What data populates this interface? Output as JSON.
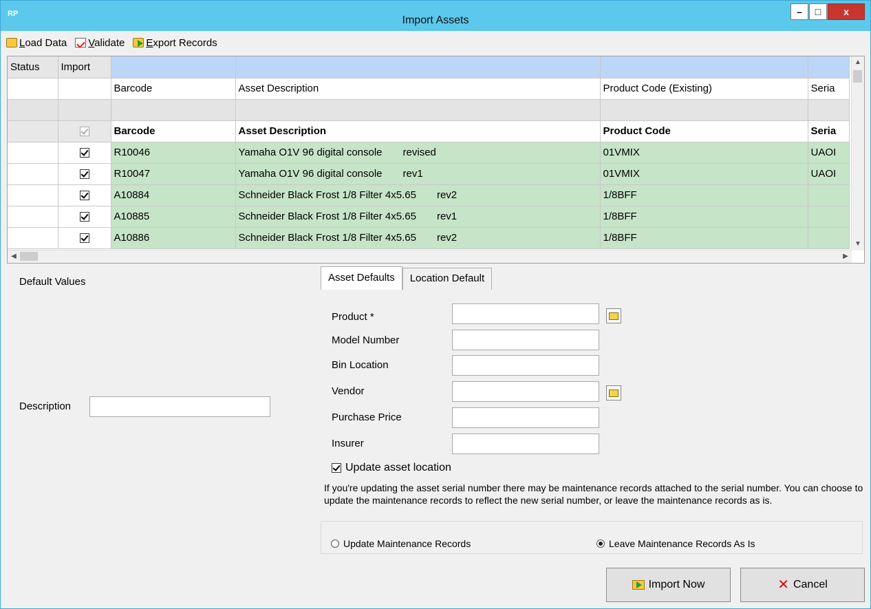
{
  "window": {
    "app_icon": "RP",
    "title": "Import Assets",
    "controls": {
      "minimize": "–",
      "maximize": "□",
      "close": "x"
    }
  },
  "toolbar": {
    "load_data": "Load Data",
    "validate": "Validate",
    "export_records": "Export Records"
  },
  "grid": {
    "fixed_headers": [
      "Status",
      "Import"
    ],
    "mapping_row": [
      "Barcode",
      "Asset Description",
      "Product Code (Existing)",
      "Seria"
    ],
    "field_row": [
      "Barcode",
      "Asset Description",
      "Product Code",
      "Seria"
    ],
    "rows": [
      {
        "checked": true,
        "barcode": "R10046",
        "description": "Yamaha O1V 96 digital console",
        "rev": "revised",
        "product": "01VMIX",
        "serial": "UAOI"
      },
      {
        "checked": true,
        "barcode": "R10047",
        "description": "Yamaha O1V 96 digital console",
        "rev": "rev1",
        "product": "01VMIX",
        "serial": "UAOI"
      },
      {
        "checked": true,
        "barcode": "A10884",
        "description": "Schneider Black Frost 1/8 Filter 4x5.65",
        "rev": "rev2",
        "product": "1/8BFF",
        "serial": ""
      },
      {
        "checked": true,
        "barcode": "A10885",
        "description": "Schneider Black Frost 1/8 Filter 4x5.65",
        "rev": "rev1",
        "product": "1/8BFF",
        "serial": ""
      },
      {
        "checked": true,
        "barcode": "A10886",
        "description": "Schneider Black Frost 1/8 Filter 4x5.65",
        "rev": "rev2",
        "product": "1/8BFF",
        "serial": ""
      }
    ]
  },
  "defaults": {
    "heading": "Default Values",
    "description_label": "Description",
    "description_value": ""
  },
  "tabs": [
    "Asset Defaults",
    "Location Default"
  ],
  "form": {
    "product_label": "Product *",
    "model_label": "Model Number",
    "bin_label": "Bin Location",
    "vendor_label": "Vendor",
    "price_label": "Purchase Price",
    "insurer_label": "Insurer",
    "update_location_label": "Update asset location",
    "update_location_checked": true,
    "note": "If you're updating the asset serial number there may be maintenance records attached to the serial number. You can choose to update the maintenance records to reflect the new serial number, or leave the maintenance records as is.",
    "radio_update": "Update Maintenance Records",
    "radio_leave": "Leave Maintenance Records As Is",
    "selected_radio": "leave"
  },
  "buttons": {
    "import_now": "Import Now",
    "cancel": "Cancel"
  }
}
